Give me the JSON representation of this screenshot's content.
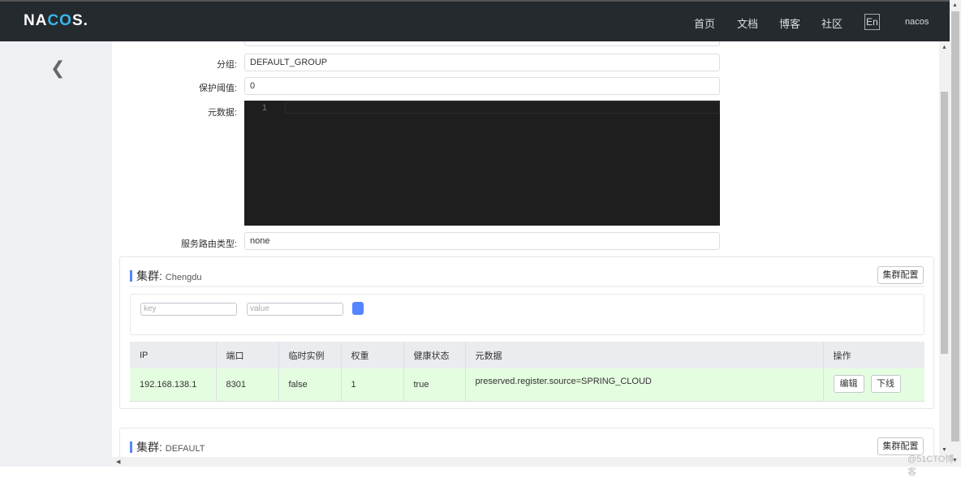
{
  "header": {
    "logo": "NACOS.",
    "nav": [
      "首页",
      "文档",
      "博客",
      "社区"
    ],
    "lang": "En",
    "user": "nacos"
  },
  "form": {
    "group_label": "分组:",
    "group_value": "DEFAULT_GROUP",
    "threshold_label": "保护阈值:",
    "threshold_value": "0",
    "metadata_label": "元数据:",
    "editor_line": "1",
    "selector_label": "服务路由类型:",
    "selector_value": "none"
  },
  "clusters": [
    {
      "title": "集群:",
      "name": "Chengdu",
      "config_btn": "集群配置",
      "filter": {
        "key_placeholder": "key",
        "value_placeholder": "value"
      },
      "columns": [
        "IP",
        "端口",
        "临时实例",
        "权重",
        "健康状态",
        "元数据",
        "操作"
      ],
      "rows": [
        {
          "ip": "192.168.138.1",
          "port": "8301",
          "ephemeral": "false",
          "weight": "1",
          "healthy": "true",
          "metadata": "preserved.register.source=SPRING_CLOUD",
          "edit": "编辑",
          "offline": "下线"
        }
      ]
    },
    {
      "title": "集群:",
      "name": "DEFAULT",
      "config_btn": "集群配置"
    }
  ],
  "watermark": "@51CTO博客",
  "colors": {
    "header": "#252a2f",
    "accent": "#5584ff",
    "healthy_row": "#e4fde0"
  }
}
